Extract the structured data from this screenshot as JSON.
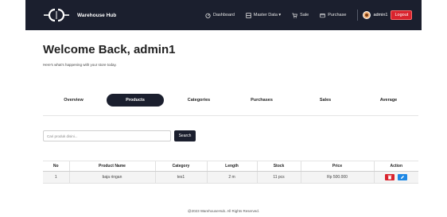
{
  "brand": {
    "name": "Warehouse Hub",
    "logo_icon": "warehouse-hub-logo-icon"
  },
  "nav": {
    "items": [
      {
        "label": "Dashboard",
        "icon": "dashboard-icon"
      },
      {
        "label": "Master Data ▾",
        "icon": "master-data-icon"
      },
      {
        "label": "Sale",
        "icon": "cart-icon"
      },
      {
        "label": "Purchase",
        "icon": "purchase-icon"
      }
    ],
    "user": "admin1",
    "logout": "Logout"
  },
  "header": {
    "title": "Welcome Back, admin1",
    "subtitle": "Here's what's happening with your store today."
  },
  "tabs": [
    {
      "label": "Overview",
      "active": false
    },
    {
      "label": "Products",
      "active": true
    },
    {
      "label": "Categories",
      "active": false
    },
    {
      "label": "Purchases",
      "active": false
    },
    {
      "label": "Sales",
      "active": false
    },
    {
      "label": "Average",
      "active": false
    }
  ],
  "search": {
    "placeholder": "Cari produk disini...",
    "button": "Search"
  },
  "table": {
    "headers": [
      "No",
      "Product Name",
      "Category",
      "Length",
      "Stock",
      "Price",
      "Action"
    ],
    "rows": [
      [
        "1",
        "baja ringan",
        "tes1",
        "2 m",
        "11 pcs",
        "Rp 500.000"
      ]
    ]
  },
  "footer": "@2023 WarehouseHub. All Rights Reserved.",
  "colors": {
    "navbar": "#1b1f2e",
    "logout": "#d9232d",
    "edit": "#1e88e5",
    "delete": "#d9232d"
  }
}
